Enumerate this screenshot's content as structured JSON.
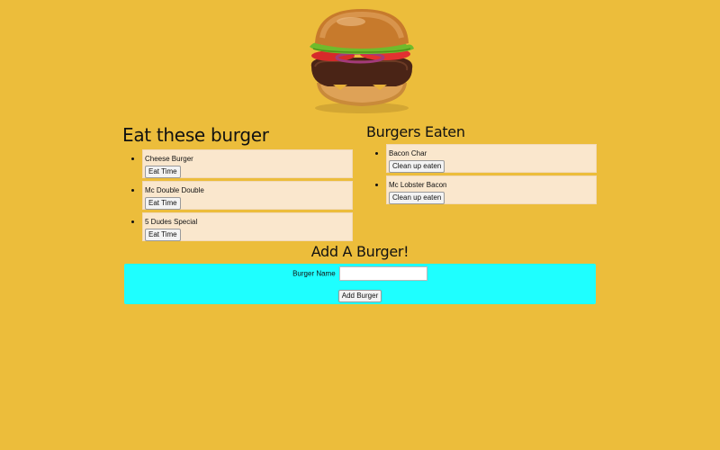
{
  "eat": {
    "heading": "Eat these burger",
    "button_label": "Eat Time",
    "items": [
      {
        "name": "Cheese Burger"
      },
      {
        "name": "Mc Double Double"
      },
      {
        "name": "5 Dudes Special"
      }
    ]
  },
  "eaten": {
    "heading": "Burgers Eaten",
    "button_label": "Clean up eaten",
    "items": [
      {
        "name": "Bacon Char"
      },
      {
        "name": "Mc Lobster Bacon"
      }
    ]
  },
  "add": {
    "heading": "Add A Burger!",
    "name_label": "Burger Name",
    "name_value": "",
    "submit_label": "Add Burger"
  },
  "colors": {
    "page_background": "#ecbd3b",
    "form_background": "#1effff",
    "list_item_background": "#fae7cd"
  }
}
